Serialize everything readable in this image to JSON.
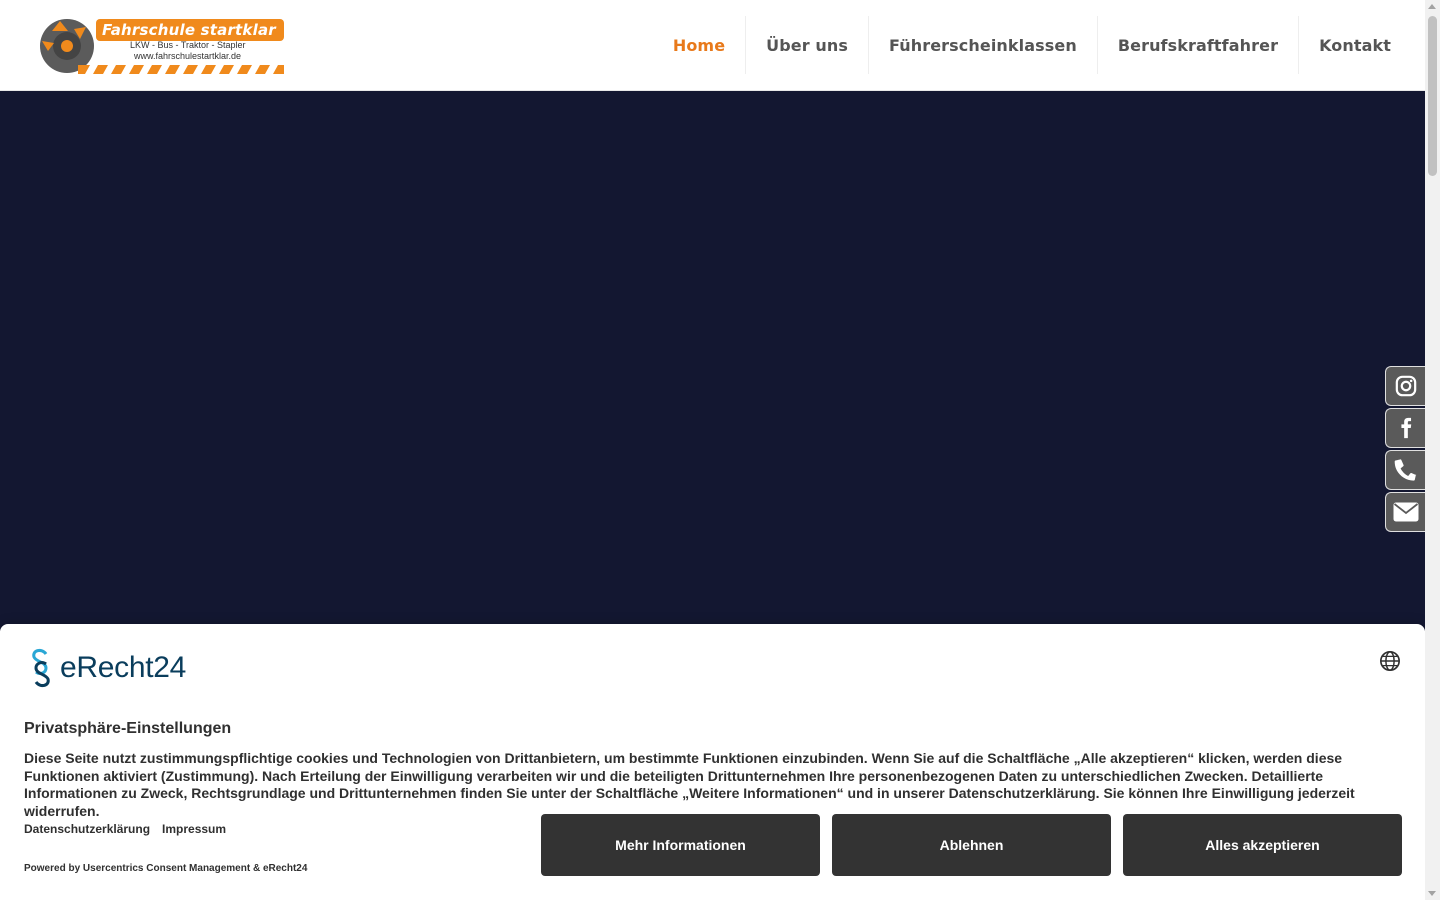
{
  "logo": {
    "title": "Fahrschule startklar",
    "tagline": "LKW - Bus - Traktor - Stapler",
    "url": "www.fahrschulestartklar.de",
    "colors": {
      "orange": "#f08a1c",
      "gray": "#5b5b5b"
    }
  },
  "nav": {
    "items": [
      {
        "label": "Home",
        "active": true
      },
      {
        "label": "Über uns"
      },
      {
        "label": "Führerscheinklassen"
      },
      {
        "label": "Berufskraftfahrer"
      },
      {
        "label": "Kontakt"
      }
    ],
    "active_color": "#e8791a"
  },
  "hero": {
    "background": "#131731"
  },
  "social": {
    "icons": [
      "instagram-icon",
      "facebook-icon",
      "phone-icon",
      "envelope-icon"
    ]
  },
  "consent": {
    "brand": "eRecht24",
    "title": "Privatsphäre-Einstellungen",
    "text": "Diese Seite nutzt zustimmungspflichtige cookies und Technologien von Drittanbietern, um bestimmte Funktionen einzubinden. Wenn Sie auf die Schaltfläche „Alle akzeptieren“ klicken, werden diese Funktionen aktiviert (Zustimmung). Nach Erteilung der Einwilligung verarbeiten wir und die beteiligten Drittunternehmen Ihre personenbezogenen Daten zu unterschiedlichen Zwecken. Detaillierte Informationen zu Zweck, Rechtsgrundlage und Drittunternehmen finden Sie unter der Schaltfläche „Weitere Informationen“ und in unserer Datenschutzerklärung. Sie können Ihre Einwilligung jederzeit widerrufen.",
    "links": {
      "privacy": "Datenschutzerklärung",
      "imprint": "Impressum"
    },
    "powered": "Powered by Usercentrics Consent Management & eRecht24",
    "buttons": {
      "more": "Mehr Informationen",
      "deny": "Ablehnen",
      "accept": "Alles akzeptieren"
    },
    "button_color": "#333333"
  }
}
